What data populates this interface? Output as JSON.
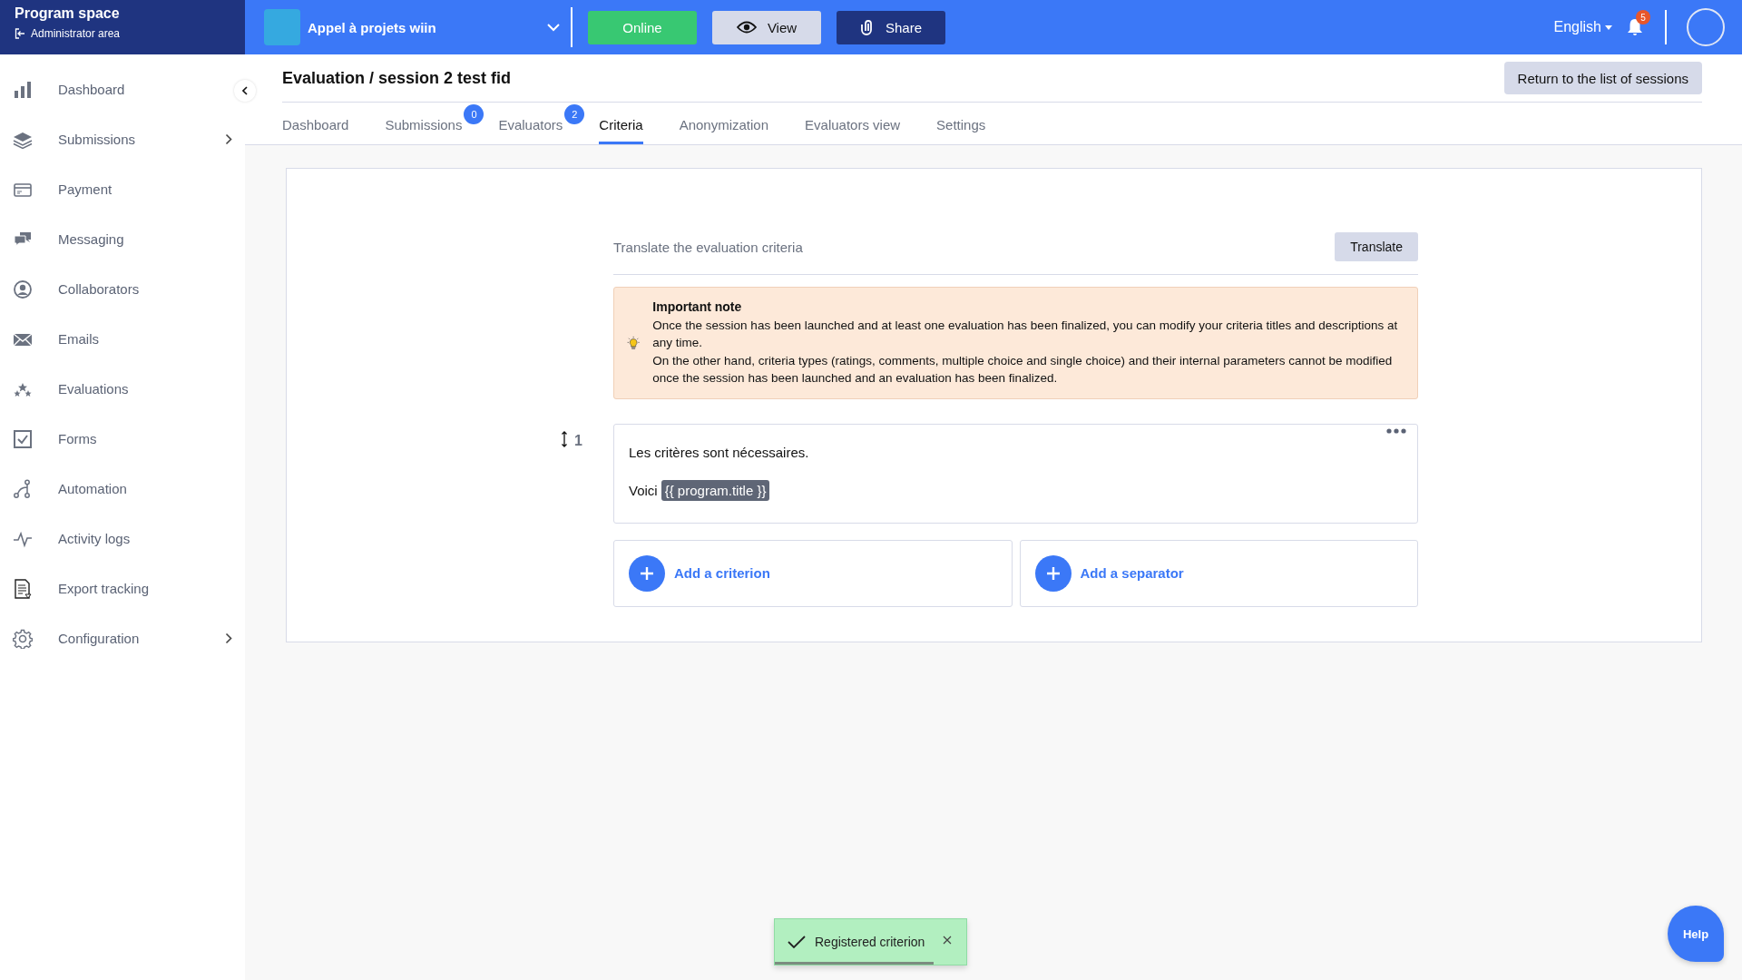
{
  "sidebar": {
    "title": "Program space",
    "subtitle": "Administrator area",
    "items": [
      {
        "label": "Dashboard",
        "has_submenu": false
      },
      {
        "label": "Submissions",
        "has_submenu": true
      },
      {
        "label": "Payment",
        "has_submenu": false
      },
      {
        "label": "Messaging",
        "has_submenu": false
      },
      {
        "label": "Collaborators",
        "has_submenu": false
      },
      {
        "label": "Emails",
        "has_submenu": false
      },
      {
        "label": "Evaluations",
        "has_submenu": false
      },
      {
        "label": "Forms",
        "has_submenu": false
      },
      {
        "label": "Automation",
        "has_submenu": false
      },
      {
        "label": "Activity logs",
        "has_submenu": false
      },
      {
        "label": "Export tracking",
        "has_submenu": false
      },
      {
        "label": "Configuration",
        "has_submenu": true
      }
    ]
  },
  "topbar": {
    "program": "Appel à projets wiin",
    "buttons": [
      {
        "label": "Online",
        "kind": "status"
      },
      {
        "label": "View",
        "kind": "view"
      },
      {
        "label": "Share",
        "kind": "share"
      }
    ],
    "language": "English",
    "notifications": "5"
  },
  "page": {
    "title": "Evaluation / session 2 test fid",
    "return_button": "Return to the list of sessions",
    "tabs": [
      {
        "label": "Dashboard",
        "selected": false
      },
      {
        "label": "Submissions",
        "selected": false,
        "badge": "0"
      },
      {
        "label": "Evaluators",
        "selected": false,
        "badge": "2"
      },
      {
        "label": "Criteria",
        "selected": true
      },
      {
        "label": "Anonymization",
        "selected": false
      },
      {
        "label": "Evaluators view",
        "selected": false
      },
      {
        "label": "Settings",
        "selected": false
      }
    ]
  },
  "criteria": {
    "translate_label": "Translate the evaluation criteria",
    "translate_button": "Translate",
    "note": {
      "title": "Important note",
      "paragraphs": [
        "Once the session has been launched and at least one evaluation has been finalized, you can modify your criteria titles and descriptions at any time.",
        "On the other hand, criteria types (ratings, comments, multiple choice and single choice) and their internal parameters cannot be modified once the session has been launched and an evaluation has been finalized."
      ]
    },
    "items": [
      {
        "number": "1",
        "text": "Les critères sont nécessaires.",
        "prefix": "Voici",
        "tag": "{{ program.title }}"
      }
    ],
    "add_buttons": [
      "Add a criterion",
      "Add a separator"
    ]
  },
  "toast": {
    "text": "Registered criterion",
    "level": 0.83
  },
  "help": "Help"
}
